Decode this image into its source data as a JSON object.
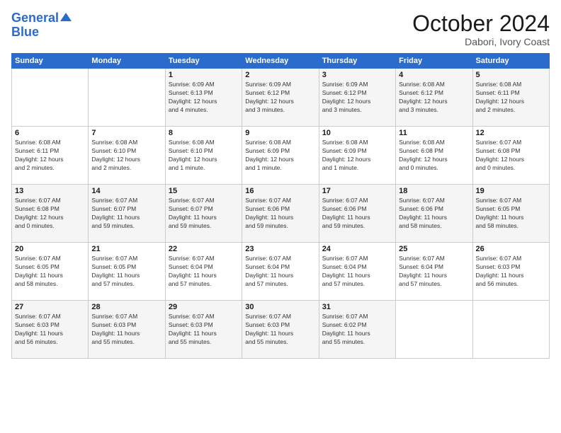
{
  "logo": {
    "line1": "General",
    "line2": "Blue"
  },
  "title": "October 2024",
  "location": "Dabori, Ivory Coast",
  "days_of_week": [
    "Sunday",
    "Monday",
    "Tuesday",
    "Wednesday",
    "Thursday",
    "Friday",
    "Saturday"
  ],
  "weeks": [
    [
      {
        "num": "",
        "info": ""
      },
      {
        "num": "",
        "info": ""
      },
      {
        "num": "1",
        "info": "Sunrise: 6:09 AM\nSunset: 6:13 PM\nDaylight: 12 hours\nand 4 minutes."
      },
      {
        "num": "2",
        "info": "Sunrise: 6:09 AM\nSunset: 6:12 PM\nDaylight: 12 hours\nand 3 minutes."
      },
      {
        "num": "3",
        "info": "Sunrise: 6:09 AM\nSunset: 6:12 PM\nDaylight: 12 hours\nand 3 minutes."
      },
      {
        "num": "4",
        "info": "Sunrise: 6:08 AM\nSunset: 6:12 PM\nDaylight: 12 hours\nand 3 minutes."
      },
      {
        "num": "5",
        "info": "Sunrise: 6:08 AM\nSunset: 6:11 PM\nDaylight: 12 hours\nand 2 minutes."
      }
    ],
    [
      {
        "num": "6",
        "info": "Sunrise: 6:08 AM\nSunset: 6:11 PM\nDaylight: 12 hours\nand 2 minutes."
      },
      {
        "num": "7",
        "info": "Sunrise: 6:08 AM\nSunset: 6:10 PM\nDaylight: 12 hours\nand 2 minutes."
      },
      {
        "num": "8",
        "info": "Sunrise: 6:08 AM\nSunset: 6:10 PM\nDaylight: 12 hours\nand 1 minute."
      },
      {
        "num": "9",
        "info": "Sunrise: 6:08 AM\nSunset: 6:09 PM\nDaylight: 12 hours\nand 1 minute."
      },
      {
        "num": "10",
        "info": "Sunrise: 6:08 AM\nSunset: 6:09 PM\nDaylight: 12 hours\nand 1 minute."
      },
      {
        "num": "11",
        "info": "Sunrise: 6:08 AM\nSunset: 6:08 PM\nDaylight: 12 hours\nand 0 minutes."
      },
      {
        "num": "12",
        "info": "Sunrise: 6:07 AM\nSunset: 6:08 PM\nDaylight: 12 hours\nand 0 minutes."
      }
    ],
    [
      {
        "num": "13",
        "info": "Sunrise: 6:07 AM\nSunset: 6:08 PM\nDaylight: 12 hours\nand 0 minutes."
      },
      {
        "num": "14",
        "info": "Sunrise: 6:07 AM\nSunset: 6:07 PM\nDaylight: 11 hours\nand 59 minutes."
      },
      {
        "num": "15",
        "info": "Sunrise: 6:07 AM\nSunset: 6:07 PM\nDaylight: 11 hours\nand 59 minutes."
      },
      {
        "num": "16",
        "info": "Sunrise: 6:07 AM\nSunset: 6:06 PM\nDaylight: 11 hours\nand 59 minutes."
      },
      {
        "num": "17",
        "info": "Sunrise: 6:07 AM\nSunset: 6:06 PM\nDaylight: 11 hours\nand 59 minutes."
      },
      {
        "num": "18",
        "info": "Sunrise: 6:07 AM\nSunset: 6:06 PM\nDaylight: 11 hours\nand 58 minutes."
      },
      {
        "num": "19",
        "info": "Sunrise: 6:07 AM\nSunset: 6:05 PM\nDaylight: 11 hours\nand 58 minutes."
      }
    ],
    [
      {
        "num": "20",
        "info": "Sunrise: 6:07 AM\nSunset: 6:05 PM\nDaylight: 11 hours\nand 58 minutes."
      },
      {
        "num": "21",
        "info": "Sunrise: 6:07 AM\nSunset: 6:05 PM\nDaylight: 11 hours\nand 57 minutes."
      },
      {
        "num": "22",
        "info": "Sunrise: 6:07 AM\nSunset: 6:04 PM\nDaylight: 11 hours\nand 57 minutes."
      },
      {
        "num": "23",
        "info": "Sunrise: 6:07 AM\nSunset: 6:04 PM\nDaylight: 11 hours\nand 57 minutes."
      },
      {
        "num": "24",
        "info": "Sunrise: 6:07 AM\nSunset: 6:04 PM\nDaylight: 11 hours\nand 57 minutes."
      },
      {
        "num": "25",
        "info": "Sunrise: 6:07 AM\nSunset: 6:04 PM\nDaylight: 11 hours\nand 57 minutes."
      },
      {
        "num": "26",
        "info": "Sunrise: 6:07 AM\nSunset: 6:03 PM\nDaylight: 11 hours\nand 56 minutes."
      }
    ],
    [
      {
        "num": "27",
        "info": "Sunrise: 6:07 AM\nSunset: 6:03 PM\nDaylight: 11 hours\nand 56 minutes."
      },
      {
        "num": "28",
        "info": "Sunrise: 6:07 AM\nSunset: 6:03 PM\nDaylight: 11 hours\nand 55 minutes."
      },
      {
        "num": "29",
        "info": "Sunrise: 6:07 AM\nSunset: 6:03 PM\nDaylight: 11 hours\nand 55 minutes."
      },
      {
        "num": "30",
        "info": "Sunrise: 6:07 AM\nSunset: 6:03 PM\nDaylight: 11 hours\nand 55 minutes."
      },
      {
        "num": "31",
        "info": "Sunrise: 6:07 AM\nSunset: 6:02 PM\nDaylight: 11 hours\nand 55 minutes."
      },
      {
        "num": "",
        "info": ""
      },
      {
        "num": "",
        "info": ""
      }
    ]
  ]
}
